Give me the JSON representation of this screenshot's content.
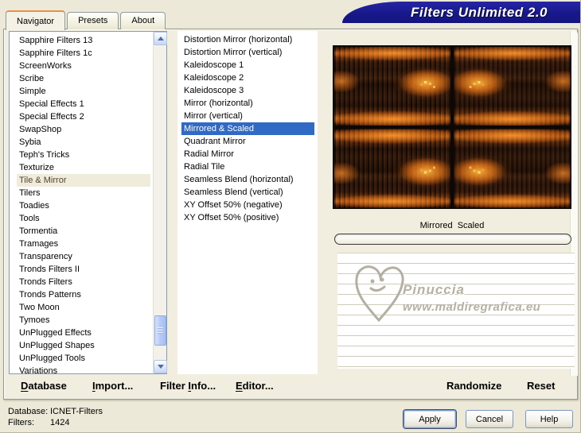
{
  "title_bar": {
    "title": "Filters Unlimited 2.0"
  },
  "tabs": {
    "active": "Navigator",
    "items": [
      {
        "label": "Navigator"
      },
      {
        "label": "Presets"
      },
      {
        "label": "About"
      }
    ]
  },
  "category_list": {
    "selected": "Tile & Mirror",
    "items": [
      "Sapphire Filters 13",
      "Sapphire Filters 1c",
      "ScreenWorks",
      "Scribe",
      "Simple",
      "Special Effects 1",
      "Special Effects 2",
      "SwapShop",
      "Sybia",
      "Teph's Tricks",
      "Texturize",
      "Tile & Mirror",
      "Tilers",
      "Toadies",
      "Tools",
      "Tormentia",
      "Tramages",
      "Transparency",
      "Tronds Filters II",
      "Tronds Filters",
      "Tronds Patterns",
      "Two Moon",
      "Tymoes",
      "UnPlugged Effects",
      "UnPlugged Shapes",
      "UnPlugged Tools",
      "Variations"
    ]
  },
  "filter_list": {
    "selected": "Mirrored & Scaled",
    "items": [
      "Distortion Mirror (horizontal)",
      "Distortion Mirror (vertical)",
      "Kaleidoscope 1",
      "Kaleidoscope 2",
      "Kaleidoscope 3",
      "Mirror (horizontal)",
      "Mirror (vertical)",
      "Mirrored & Scaled",
      "Quadrant Mirror",
      "Radial Mirror",
      "Radial Tile",
      "Seamless Blend (horizontal)",
      "Seamless Blend (vertical)",
      "XY Offset 50% (negative)",
      "XY Offset 50% (positive)"
    ]
  },
  "preview": {
    "caption": "Mirrored  Scaled"
  },
  "watermark": {
    "name": "Pinuccia",
    "url": "www.maldiregrafica.eu",
    "icon": "heart-smiley-icon"
  },
  "commands": {
    "database": {
      "pre": "",
      "key": "D",
      "post": "atabase"
    },
    "import": {
      "pre": "",
      "key": "I",
      "post": "mport..."
    },
    "filter_info": {
      "pre": "Filter ",
      "key": "I",
      "post": "nfo..."
    },
    "editor": {
      "pre": "",
      "key": "E",
      "post": "ditor..."
    },
    "randomize": {
      "label": "Randomize"
    },
    "reset": {
      "label": "Reset"
    }
  },
  "status_bar": {
    "database_label": "Database:",
    "database_value": "ICNET-Filters",
    "filters_label": "Filters:",
    "filters_value": "1424"
  },
  "action_buttons": {
    "apply": "Apply",
    "cancel": "Cancel",
    "help": "Help"
  },
  "colors": {
    "dialog_beige": "#ECE9D8",
    "banner_navy": "#18188C",
    "selection_blue": "#316AC5",
    "category_selection_bg": "#EFECDC",
    "tab_accent_orange": "#E89048"
  }
}
